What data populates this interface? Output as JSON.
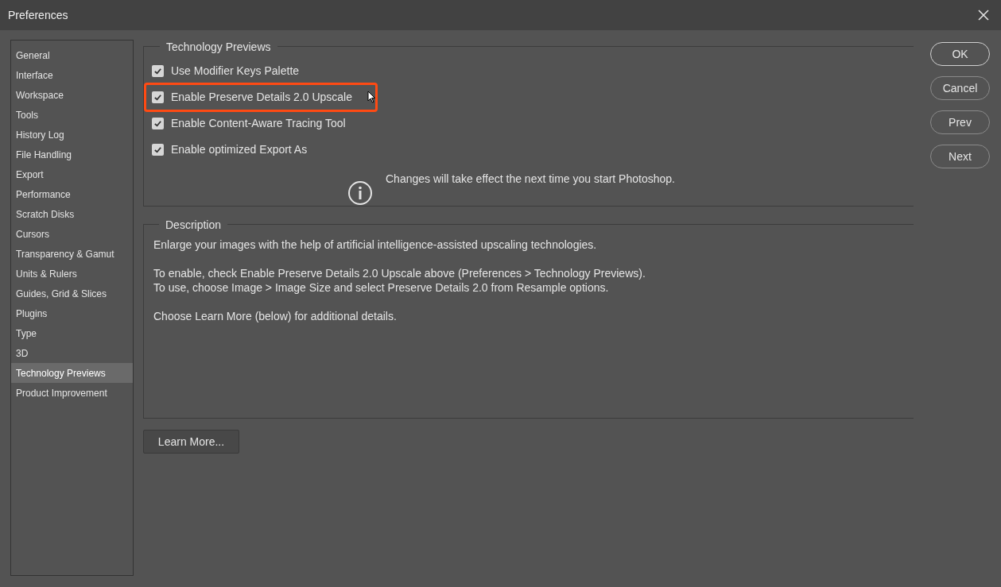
{
  "window": {
    "title": "Preferences"
  },
  "sidebar": {
    "items": [
      {
        "label": "General",
        "selected": false
      },
      {
        "label": "Interface",
        "selected": false
      },
      {
        "label": "Workspace",
        "selected": false
      },
      {
        "label": "Tools",
        "selected": false
      },
      {
        "label": "History Log",
        "selected": false
      },
      {
        "label": "File Handling",
        "selected": false
      },
      {
        "label": "Export",
        "selected": false
      },
      {
        "label": "Performance",
        "selected": false
      },
      {
        "label": "Scratch Disks",
        "selected": false
      },
      {
        "label": "Cursors",
        "selected": false
      },
      {
        "label": "Transparency & Gamut",
        "selected": false
      },
      {
        "label": "Units & Rulers",
        "selected": false
      },
      {
        "label": "Guides, Grid & Slices",
        "selected": false
      },
      {
        "label": "Plugins",
        "selected": false
      },
      {
        "label": "Type",
        "selected": false
      },
      {
        "label": "3D",
        "selected": false
      },
      {
        "label": "Technology Previews",
        "selected": true
      },
      {
        "label": "Product Improvement",
        "selected": false
      }
    ]
  },
  "technology_previews": {
    "title": "Technology Previews",
    "options": [
      {
        "label": "Use Modifier Keys Palette",
        "checked": true,
        "highlighted": false
      },
      {
        "label": "Enable Preserve Details 2.0 Upscale",
        "checked": true,
        "highlighted": true
      },
      {
        "label": "Enable Content-Aware Tracing Tool",
        "checked": true,
        "highlighted": false
      },
      {
        "label": "Enable optimized Export As",
        "checked": true,
        "highlighted": false
      }
    ],
    "notice": "Changes will take effect the next time you start Photoshop."
  },
  "description": {
    "title": "Description",
    "paragraphs": [
      [
        "Enlarge your images with the help of artificial intelligence-assisted upscaling technologies."
      ],
      [
        "To enable, check Enable Preserve Details 2.0 Upscale above (Preferences > Technology Previews).",
        "To use, choose Image > Image Size and select Preserve Details 2.0 from Resample options."
      ],
      [
        "Choose Learn More (below) for additional details."
      ]
    ]
  },
  "learn_more_button": "Learn More...",
  "buttons": [
    "OK",
    "Cancel",
    "Prev",
    "Next"
  ]
}
